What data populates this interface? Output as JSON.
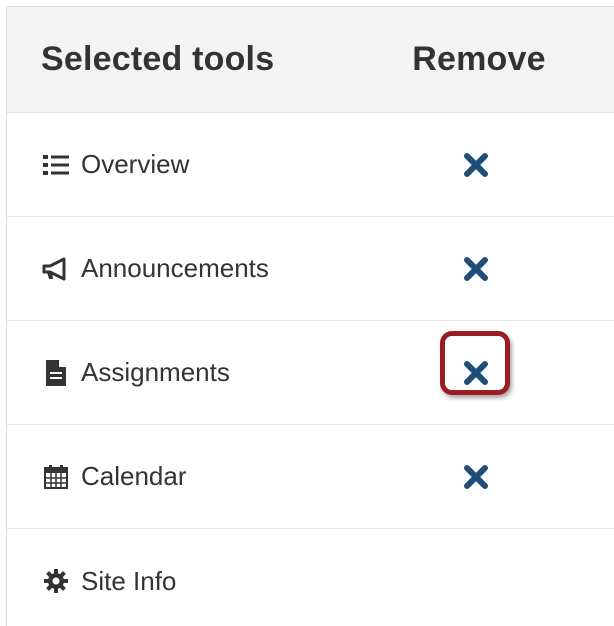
{
  "table": {
    "header": {
      "tools_label": "Selected tools",
      "remove_label": "Remove"
    },
    "rows": [
      {
        "label": "Overview",
        "icon": "list-icon",
        "removable": true
      },
      {
        "label": "Announcements",
        "icon": "megaphone-icon",
        "removable": true
      },
      {
        "label": "Assignments",
        "icon": "document-icon",
        "removable": true,
        "highlighted": true
      },
      {
        "label": "Calendar",
        "icon": "calendar-icon",
        "removable": true
      },
      {
        "label": "Site Info",
        "icon": "gear-icon",
        "removable": false
      }
    ]
  },
  "colors": {
    "remove_icon": "#1f4e78",
    "highlight_border": "#9b1c21",
    "header_background": "#f4f4f4",
    "text": "#333333"
  }
}
